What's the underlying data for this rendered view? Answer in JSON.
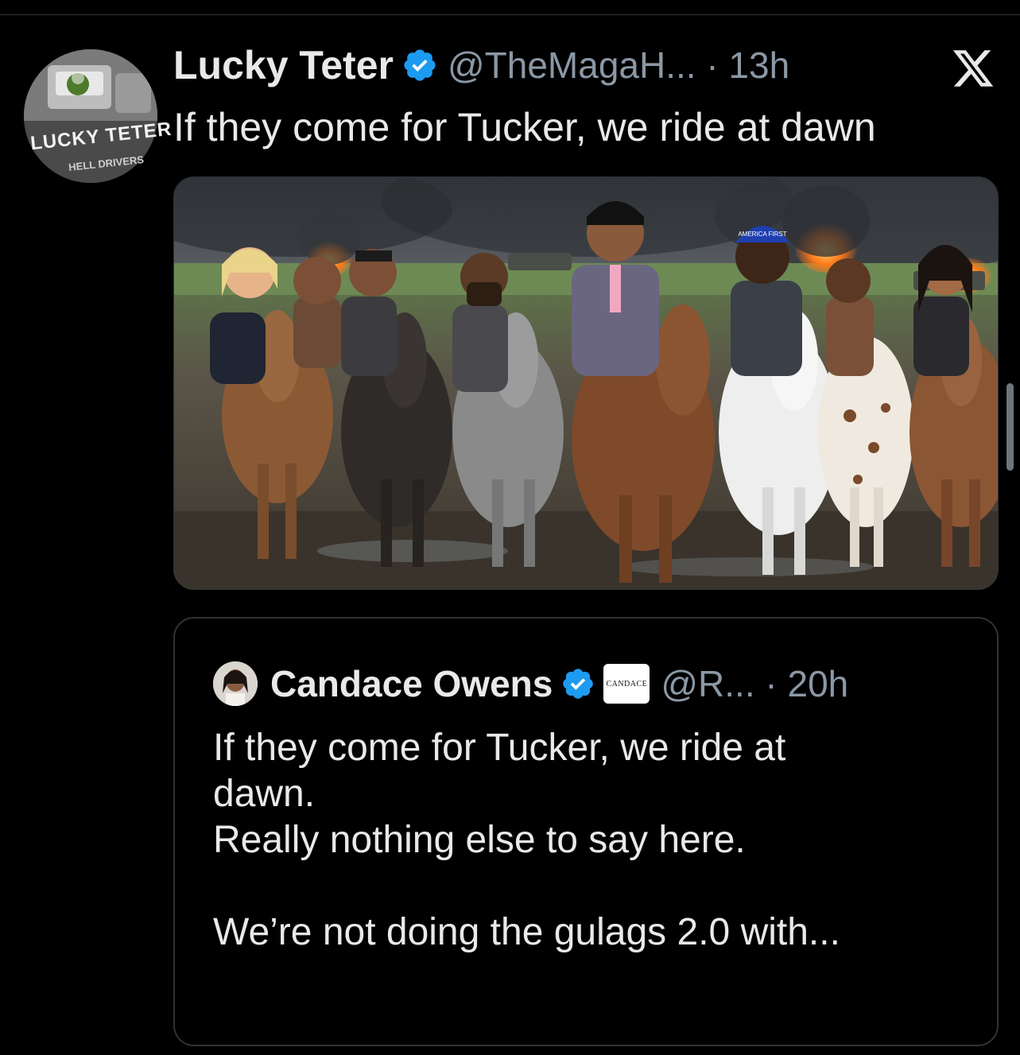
{
  "tweet": {
    "author_name": "Lucky Teter",
    "handle_time": "@TheMagaH... · 13h",
    "text": "If they come for Tucker, we ride at dawn",
    "avatar_logo": "LUCKY TETER",
    "avatar_sub": "HELL DRIVERS",
    "image_cap_text": "AMERICA FIRST"
  },
  "quoted": {
    "author_name": "Candace Owens",
    "affiliation_badge": "CANDACE",
    "handle_time": "@R... · 20h",
    "lines": [
      "If they come for Tucker, we ride at",
      "dawn.",
      "Really nothing else to say here.",
      "",
      "We’re not doing the gulags 2.0 with..."
    ]
  },
  "colors": {
    "background": "#000000",
    "text": "#e7e9ea",
    "secondary": "#8b98a5",
    "verified": "#1d9bf0",
    "border": "#2f3336"
  },
  "icons": [
    "verified-badge-icon",
    "x-logo-icon"
  ]
}
